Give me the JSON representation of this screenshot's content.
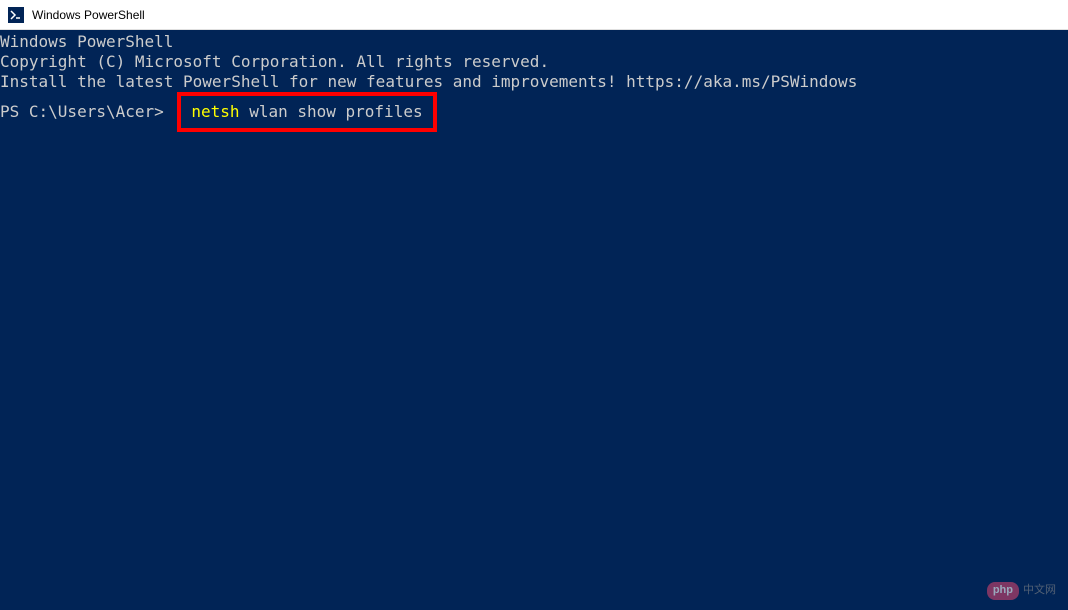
{
  "window": {
    "title": "Windows PowerShell"
  },
  "terminal": {
    "line1": "Windows PowerShell",
    "line2": "Copyright (C) Microsoft Corporation. All rights reserved.",
    "line3": "",
    "line4": "Install the latest PowerShell for new features and improvements! https://aka.ms/PSWindows",
    "line5": "",
    "prompt": "PS C:\\Users\\Acer> ",
    "command_keyword": "netsh",
    "command_args": " wlan show profiles"
  },
  "watermark": {
    "badge": "php",
    "text": "中文网"
  }
}
